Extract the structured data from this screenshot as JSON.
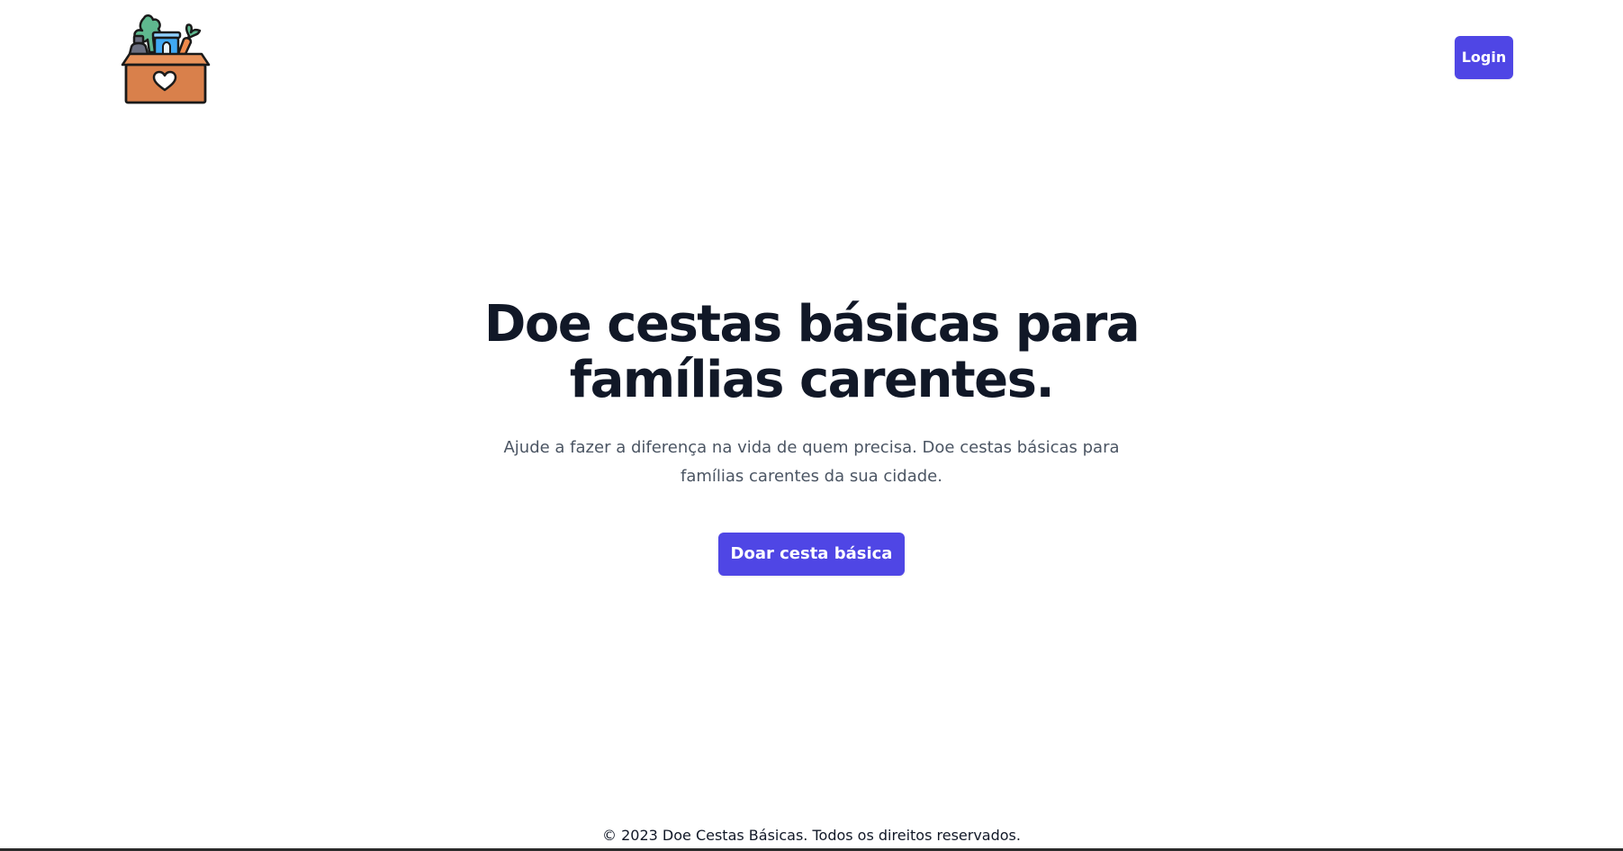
{
  "header": {
    "logo_icon": "grocery-donation-box-icon",
    "login_label": "Login"
  },
  "hero": {
    "title": "Doe cestas básicas para famílias carentes.",
    "subtitle": "Ajude a fazer a diferença na vida de quem precisa. Doe cestas básicas para famílias carentes da sua cidade.",
    "cta_label": "Doar cesta básica"
  },
  "footer": {
    "copyright": "© 2023 Doe Cestas Básicas. Todos os direitos reservados."
  },
  "colors": {
    "primary": "#4f46e5",
    "heading": "#111827",
    "body_text": "#4b5563",
    "background": "#ffffff",
    "box": "#d9804b",
    "leaves": "#5fb88f",
    "jar": "#3fa9f5",
    "carrot": "#f08a4b",
    "bottle": "#6b6f80"
  }
}
